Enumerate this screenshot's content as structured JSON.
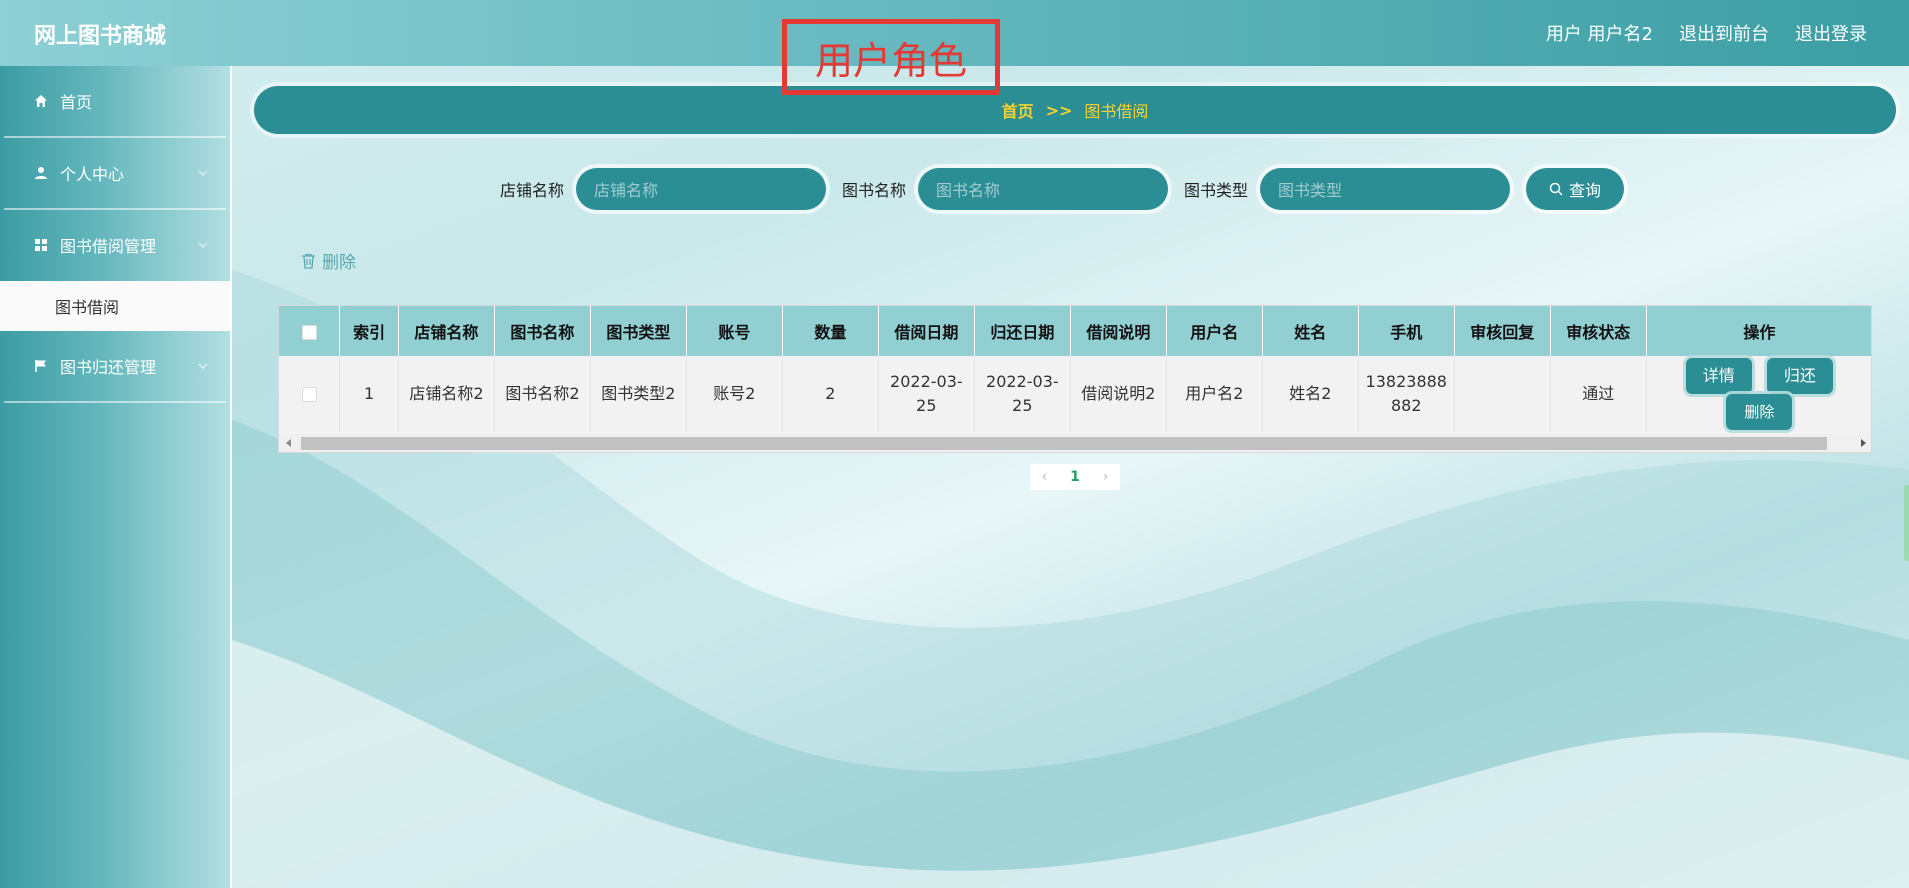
{
  "header": {
    "brand": "网上图书商城",
    "role_label": "用户角色",
    "links": [
      "用户 用户名2",
      "退出到前台",
      "退出登录"
    ]
  },
  "sidebar": {
    "items": [
      {
        "label": "首页",
        "icon": "home-icon"
      },
      {
        "label": "个人中心",
        "icon": "user-icon"
      },
      {
        "label": "图书借阅管理",
        "icon": "grid-icon"
      },
      {
        "label": "图书借阅",
        "icon": ""
      },
      {
        "label": "图书归还管理",
        "icon": "flag-icon"
      }
    ]
  },
  "breadcrumb": {
    "home": "首页",
    "separator": ">>",
    "current": "图书借阅"
  },
  "search": {
    "fields": [
      {
        "label": "店铺名称",
        "placeholder": "店铺名称"
      },
      {
        "label": "图书名称",
        "placeholder": "图书名称"
      },
      {
        "label": "图书类型",
        "placeholder": "图书类型"
      }
    ],
    "button": "查询"
  },
  "actions": {
    "delete": "删除"
  },
  "table": {
    "columns": [
      "索引",
      "店铺名称",
      "图书名称",
      "图书类型",
      "账号",
      "数量",
      "借阅日期",
      "归还日期",
      "借阅说明",
      "用户名",
      "姓名",
      "手机",
      "审核回复",
      "审核状态",
      "操作"
    ],
    "rows": [
      {
        "index": "1",
        "shop": "店铺名称2",
        "book": "图书名称2",
        "type": "图书类型2",
        "account": "账号2",
        "qty": "2",
        "borrow_date": "2022-03-25",
        "return_date": "2022-03-25",
        "note": "借阅说明2",
        "username": "用户名2",
        "name": "姓名2",
        "phone": "13823888882",
        "reply": "",
        "status": "通过",
        "ops": [
          "详情",
          "归还",
          "删除"
        ]
      }
    ]
  },
  "pagination": {
    "current": "1"
  },
  "colors": {
    "primary": "#2b8e94",
    "header_row": "#92cfd3",
    "breadcrumb_text": "#f6d32d",
    "role_box": "#e53935"
  }
}
